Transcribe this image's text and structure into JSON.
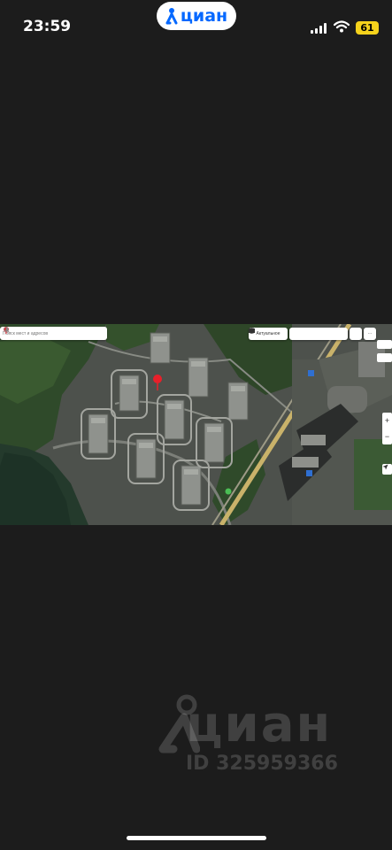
{
  "status_bar": {
    "time": "23:59",
    "app_badge": "циан",
    "battery": "61",
    "battery_color": "#f5d21c"
  },
  "map": {
    "search": {
      "placeholder": "Поиск мест и адресов"
    },
    "toolbar": {
      "actual_label": "Актуальное"
    }
  },
  "watermark": {
    "brand": "циан",
    "id_text": "ID 325959366"
  },
  "colors": {
    "background": "#1c1c1c",
    "brand_blue": "#0468ff",
    "pin_red": "#e8202a"
  },
  "icons": [
    "cian-logo-icon",
    "signal-icon",
    "wifi-icon",
    "battery-icon",
    "pin-icon",
    "search-icon",
    "voice-icon",
    "layers-icon",
    "zoom-in-icon",
    "zoom-out-icon",
    "locate-icon"
  ]
}
